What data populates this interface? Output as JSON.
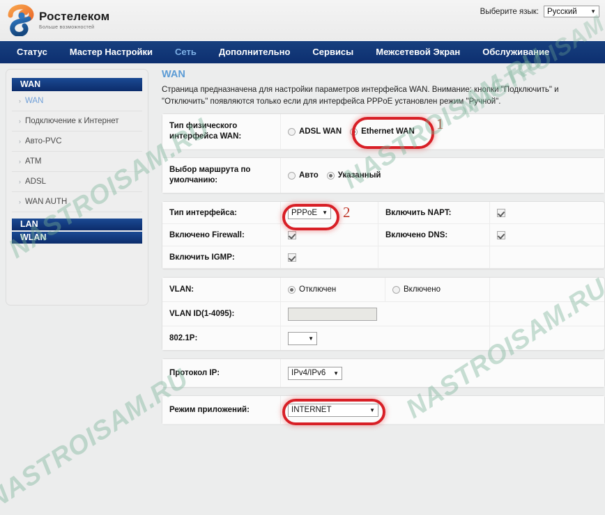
{
  "brand": {
    "name": "Ростелеком",
    "tagline": "Больше возможностей",
    "logo_icon": "rostelecom-swoosh-icon",
    "accent_blue": "#12377e",
    "accent_orange": "#f07f2a",
    "link_blue": "#5b9bd5",
    "highlight_red": "#d81f26"
  },
  "language": {
    "label": "Выберите язык:",
    "value": "Русский",
    "caret_icon": "chevron-down-icon"
  },
  "nav": {
    "items": [
      {
        "label": "Статус",
        "active": false
      },
      {
        "label": "Мастер Настройки",
        "active": false
      },
      {
        "label": "Сеть",
        "active": true
      },
      {
        "label": "Дополнительно",
        "active": false
      },
      {
        "label": "Сервисы",
        "active": false
      },
      {
        "label": "Межсетевой Экран",
        "active": false
      },
      {
        "label": "Обслуживание",
        "active": false
      }
    ]
  },
  "sidebar": {
    "group_wan": "WAN",
    "links": [
      {
        "label": "WAN",
        "current": true
      },
      {
        "label": "Подключение к Интернет",
        "current": false
      },
      {
        "label": "Авто-PVC",
        "current": false
      },
      {
        "label": "ATM",
        "current": false
      },
      {
        "label": "ADSL",
        "current": false
      },
      {
        "label": "WAN AUTH",
        "current": false
      }
    ],
    "group_lan": "LAN",
    "group_wlan": "WLAN",
    "arrow_icon": "chevron-right-icon"
  },
  "main": {
    "title": "WAN",
    "description": "Страница предназначена для настройки параметров интерфейса WAN. Внимание: кнопки \"Подключить\" и \"Отключить\" появляются только если для интерфейса PPPoE установлен режим \"Ручной\"."
  },
  "panel_phys": {
    "label_line1": "Тип физического",
    "label_line2": "интерфейса WAN:",
    "options": [
      {
        "label": "ADSL WAN",
        "selected": false
      },
      {
        "label": "Ethernet WAN",
        "selected": true
      }
    ],
    "callout": "1"
  },
  "panel_route": {
    "label_line1": "Выбор маршрута по",
    "label_line2": "умолчанию:",
    "options": [
      {
        "label": "Авто",
        "selected": false
      },
      {
        "label": "Указанный",
        "selected": true
      }
    ]
  },
  "panel_iface": {
    "callout": "2",
    "rows": [
      {
        "left_label": "Тип интерфейса:",
        "left_control": "select",
        "left_value": "PPPoE",
        "right_label": "Включить NAPT:",
        "right_control": "checkbox",
        "right_checked": true
      },
      {
        "left_label": "Включено Firewall:",
        "left_control": "checkbox",
        "left_checked": true,
        "right_label": "Включено DNS:",
        "right_control": "checkbox",
        "right_checked": true
      },
      {
        "left_label": "Включить IGMP:",
        "left_control": "checkbox",
        "left_checked": true,
        "right_label": "",
        "right_control": "none",
        "right_checked": false
      }
    ]
  },
  "panel_vlan": {
    "vlan_label": "VLAN:",
    "vlan_options": [
      {
        "label": "Отключен",
        "selected": true
      },
      {
        "label": "Включено",
        "selected": false
      }
    ],
    "vlan_id_label": "VLAN ID(1-4095):",
    "vlan_id_value": "",
    "dot1p_label": "802.1P:",
    "dot1p_value": ""
  },
  "panel_ip": {
    "label": "Протокол IP:",
    "value": "IPv4/IPv6"
  },
  "panel_appmode": {
    "label": "Режим приложений:",
    "value": "INTERNET"
  },
  "watermark": {
    "text": "NASTROISAM.RU"
  }
}
